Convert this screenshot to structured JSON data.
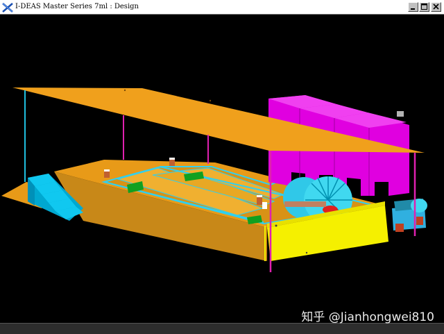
{
  "window": {
    "title": "I-DEAS Master Series 7ml : Design"
  },
  "watermark": {
    "text": "知乎 @Jianhongwei810"
  },
  "colors": {
    "roof": "#f0a01c",
    "deck": "#e89a18",
    "wall_front": "#c88818",
    "tank_wall_yellow": "#f5f000",
    "stairs": "#00b8e0",
    "cabinets": "#e000e0",
    "wheel": "#40d8f0",
    "green_panel": "#10a020",
    "post_magenta": "#e020b0",
    "post_blue": "#20c0e0"
  },
  "icons": {
    "app": "ideas-logo-icon",
    "minimize": "minimize-icon",
    "maximize": "maximize-icon",
    "close": "close-icon"
  }
}
